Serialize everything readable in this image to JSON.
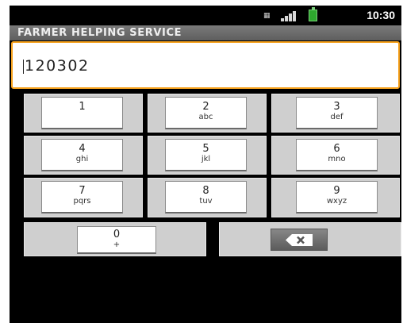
{
  "status_bar": {
    "sim_icon": "sim-card-icon",
    "signal_icon": "signal-strength-icon",
    "battery_icon": "battery-charging-icon",
    "time": "10:30"
  },
  "app": {
    "title": "FARMER HELPING SERVICE"
  },
  "input": {
    "value": "120302"
  },
  "keypad": {
    "keys": [
      {
        "digit": "1",
        "letters": ""
      },
      {
        "digit": "2",
        "letters": "abc"
      },
      {
        "digit": "3",
        "letters": "def"
      },
      {
        "digit": "4",
        "letters": "ghi"
      },
      {
        "digit": "5",
        "letters": "jkl"
      },
      {
        "digit": "6",
        "letters": "mno"
      },
      {
        "digit": "7",
        "letters": "pqrs"
      },
      {
        "digit": "8",
        "letters": "tuv"
      },
      {
        "digit": "9",
        "letters": "wxyz"
      }
    ],
    "zero": {
      "digit": "0",
      "letters": "+"
    },
    "delete_icon": "backspace-icon"
  },
  "colors": {
    "focus_border": "#f6a11c",
    "battery": "#2ea82e"
  }
}
